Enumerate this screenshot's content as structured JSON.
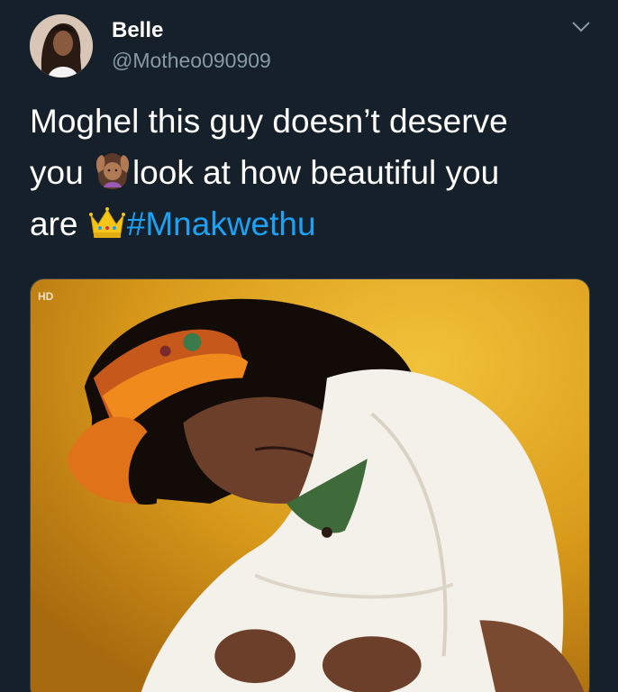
{
  "tweet": {
    "display_name": "Belle",
    "handle": "@Motheo090909",
    "text_parts": {
      "line1": "Moghel this guy doesn’t deserve",
      "line2_a": "you ",
      "line2_b": "look at how beautiful you",
      "line3_a": "are ",
      "hashtag": "#Mnakwethu"
    },
    "emojis": [
      "woman-gesturing-ok-icon",
      "crown-icon"
    ],
    "media": {
      "badge": "HD",
      "description_icon": "photo"
    }
  },
  "colors": {
    "background": "#15202b",
    "text": "#ffffff",
    "secondary_text": "#8899a6",
    "link": "#1da1f2",
    "border": "#38444d"
  }
}
